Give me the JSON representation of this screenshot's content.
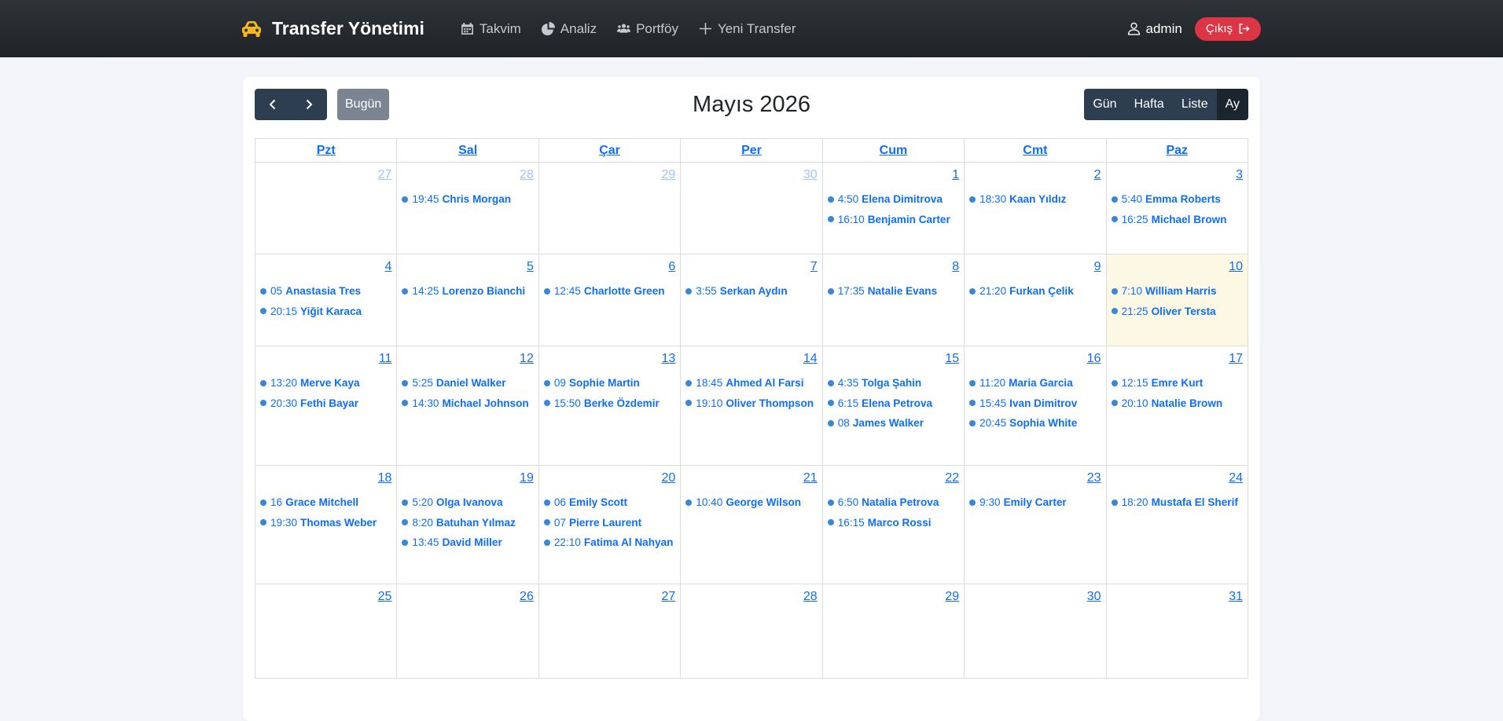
{
  "nav": {
    "brand": "Transfer Yönetimi",
    "links": [
      {
        "label": "Takvim",
        "icon": "calendar-icon"
      },
      {
        "label": "Analiz",
        "icon": "pie-chart-icon"
      },
      {
        "label": "Portföy",
        "icon": "users-icon"
      },
      {
        "label": "Yeni Transfer",
        "icon": "plus-icon"
      }
    ],
    "user": "admin",
    "logout": "Çıkış"
  },
  "toolbar": {
    "today": "Bugün",
    "title": "Mayıs 2026",
    "views": [
      {
        "label": "Gün",
        "active": false
      },
      {
        "label": "Hafta",
        "active": false
      },
      {
        "label": "Liste",
        "active": false
      },
      {
        "label": "Ay",
        "active": true
      }
    ]
  },
  "weekdays": [
    "Pzt",
    "Sal",
    "Çar",
    "Per",
    "Cum",
    "Cmt",
    "Paz"
  ],
  "weeks": [
    [
      {
        "day": "27",
        "other": true,
        "events": []
      },
      {
        "day": "28",
        "other": true,
        "events": [
          {
            "time": "19:45",
            "name": "Chris Morgan"
          }
        ]
      },
      {
        "day": "29",
        "other": true,
        "events": []
      },
      {
        "day": "30",
        "other": true,
        "events": []
      },
      {
        "day": "1",
        "events": [
          {
            "time": "4:50",
            "name": "Elena Dimitrova"
          },
          {
            "time": "16:10",
            "name": "Benjamin Carter"
          }
        ]
      },
      {
        "day": "2",
        "events": [
          {
            "time": "18:30",
            "name": "Kaan Yıldız"
          }
        ]
      },
      {
        "day": "3",
        "events": [
          {
            "time": "5:40",
            "name": "Emma Roberts"
          },
          {
            "time": "16:25",
            "name": "Michael Brown"
          }
        ]
      }
    ],
    [
      {
        "day": "4",
        "events": [
          {
            "time": "05",
            "name": "Anastasia Tres"
          },
          {
            "time": "20:15",
            "name": "Yiğit Karaca"
          }
        ]
      },
      {
        "day": "5",
        "events": [
          {
            "time": "14:25",
            "name": "Lorenzo Bianchi"
          }
        ]
      },
      {
        "day": "6",
        "events": [
          {
            "time": "12:45",
            "name": "Charlotte Green"
          }
        ]
      },
      {
        "day": "7",
        "events": [
          {
            "time": "3:55",
            "name": "Serkan Aydın"
          }
        ]
      },
      {
        "day": "8",
        "events": [
          {
            "time": "17:35",
            "name": "Natalie Evans"
          }
        ]
      },
      {
        "day": "9",
        "events": [
          {
            "time": "21:20",
            "name": "Furkan Çelik"
          }
        ]
      },
      {
        "day": "10",
        "today": true,
        "events": [
          {
            "time": "7:10",
            "name": "William Harris"
          },
          {
            "time": "21:25",
            "name": "Oliver Tersta"
          }
        ]
      }
    ],
    [
      {
        "day": "11",
        "events": [
          {
            "time": "13:20",
            "name": "Merve Kaya"
          },
          {
            "time": "20:30",
            "name": "Fethi Bayar"
          }
        ]
      },
      {
        "day": "12",
        "events": [
          {
            "time": "5:25",
            "name": "Daniel Walker"
          },
          {
            "time": "14:30",
            "name": "Michael Johnson"
          }
        ]
      },
      {
        "day": "13",
        "events": [
          {
            "time": "09",
            "name": "Sophie Martin"
          },
          {
            "time": "15:50",
            "name": "Berke Özdemir"
          }
        ]
      },
      {
        "day": "14",
        "events": [
          {
            "time": "18:45",
            "name": "Ahmed Al Farsi"
          },
          {
            "time": "19:10",
            "name": "Oliver Thompson"
          }
        ]
      },
      {
        "day": "15",
        "events": [
          {
            "time": "4:35",
            "name": "Tolga Şahin"
          },
          {
            "time": "6:15",
            "name": "Elena Petrova"
          },
          {
            "time": "08",
            "name": "James Walker"
          }
        ]
      },
      {
        "day": "16",
        "events": [
          {
            "time": "11:20",
            "name": "Maria Garcia"
          },
          {
            "time": "15:45",
            "name": "Ivan Dimitrov"
          },
          {
            "time": "20:45",
            "name": "Sophia White"
          }
        ]
      },
      {
        "day": "17",
        "events": [
          {
            "time": "12:15",
            "name": "Emre Kurt"
          },
          {
            "time": "20:10",
            "name": "Natalie Brown"
          }
        ]
      }
    ],
    [
      {
        "day": "18",
        "events": [
          {
            "time": "16",
            "name": "Grace Mitchell"
          },
          {
            "time": "19:30",
            "name": "Thomas Weber"
          }
        ]
      },
      {
        "day": "19",
        "events": [
          {
            "time": "5:20",
            "name": "Olga Ivanova"
          },
          {
            "time": "8:20",
            "name": "Batuhan Yılmaz"
          },
          {
            "time": "13:45",
            "name": "David Miller"
          }
        ]
      },
      {
        "day": "20",
        "events": [
          {
            "time": "06",
            "name": "Emily Scott"
          },
          {
            "time": "07",
            "name": "Pierre Laurent"
          },
          {
            "time": "22:10",
            "name": "Fatima Al Nahyan"
          }
        ]
      },
      {
        "day": "21",
        "events": [
          {
            "time": "10:40",
            "name": "George Wilson"
          }
        ]
      },
      {
        "day": "22",
        "events": [
          {
            "time": "6:50",
            "name": "Natalia Petrova"
          },
          {
            "time": "16:15",
            "name": "Marco Rossi"
          }
        ]
      },
      {
        "day": "23",
        "events": [
          {
            "time": "9:30",
            "name": "Emily Carter"
          }
        ]
      },
      {
        "day": "24",
        "events": [
          {
            "time": "18:20",
            "name": "Mustafa El Sherif"
          }
        ]
      }
    ],
    [
      {
        "day": "25",
        "events": []
      },
      {
        "day": "26",
        "events": []
      },
      {
        "day": "27",
        "events": []
      },
      {
        "day": "28",
        "events": []
      },
      {
        "day": "29",
        "events": []
      },
      {
        "day": "30",
        "events": []
      },
      {
        "day": "31",
        "events": []
      }
    ]
  ]
}
